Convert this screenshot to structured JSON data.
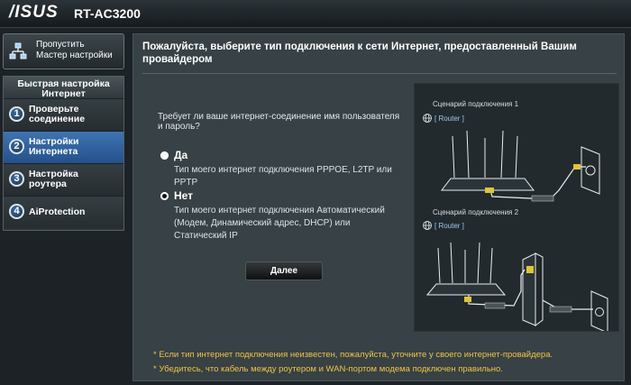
{
  "header": {
    "brand": "/ISUS",
    "model": "RT-AC3200"
  },
  "skip": {
    "label_line1": "Пропустить",
    "label_line2": "Мастер настройки"
  },
  "nav": {
    "heading_line1": "Быстрая настройка",
    "heading_line2": "Интернет",
    "items": [
      {
        "num": "1",
        "line1": "Проверьте",
        "line2": "соединение"
      },
      {
        "num": "2",
        "line1": "Настройки",
        "line2": "Интернета"
      },
      {
        "num": "3",
        "line1": "Настройка",
        "line2": "роутера"
      },
      {
        "num": "4",
        "line1": "AiProtection",
        "line2": ""
      }
    ]
  },
  "panel": {
    "title_line1": "Пожалуйста, выберите тип подключения к сети Интернет, предоставленный Вашим",
    "title_line2": "провайдером",
    "question_line1": "Требует ли ваше интернет-соединение имя пользователя",
    "question_line2": "и пароль?",
    "options": [
      {
        "title": "Да",
        "desc_line1": "Тип моего интернет подключения PPPOE, L2TP или",
        "desc_line2": "PPTP",
        "desc_line3": ""
      },
      {
        "title": "Нет",
        "desc_line1": "Тип моего интернет подключения Автоматический",
        "desc_line2": "(Модем, Динамический адрес, DHCP) или",
        "desc_line3": "Статический IP"
      }
    ],
    "next_label": "Далее",
    "diagram": {
      "scenario1": "Сценарий подключения 1",
      "scenario2": "Сценарий подключения 2",
      "router_tag": "[ Router ]"
    },
    "notes": [
      "* Если тип интернет подключения неизвестен, пожалуйста, уточните у своего интернет-провайдера.",
      "* Убедитесь, что кабель между роутером и WAN-портом модема подключен правильно."
    ]
  },
  "colors": {
    "accent": "#2f5f9c",
    "note": "#f2c43a",
    "cable": "#e0c630"
  }
}
